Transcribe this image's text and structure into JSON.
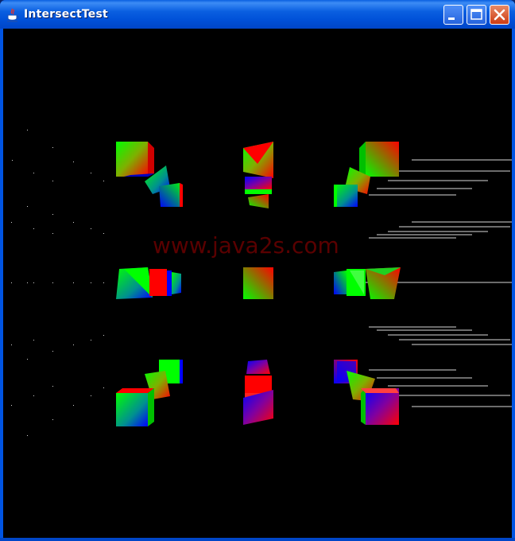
{
  "window": {
    "title": "IntersectTest",
    "buttons": [
      "minimize",
      "maximize",
      "close"
    ]
  },
  "canvas": {
    "background": "#000000",
    "watermark": "www.java2s.com"
  },
  "colors": {
    "titlebar": "#0a5fe0",
    "red": "#ff0000",
    "green": "#00ff00",
    "blue": "#0000ff"
  },
  "icons": {
    "app": "java-cup-icon",
    "minimize": "minimize-icon",
    "maximize": "maximize-icon",
    "close": "close-icon"
  }
}
